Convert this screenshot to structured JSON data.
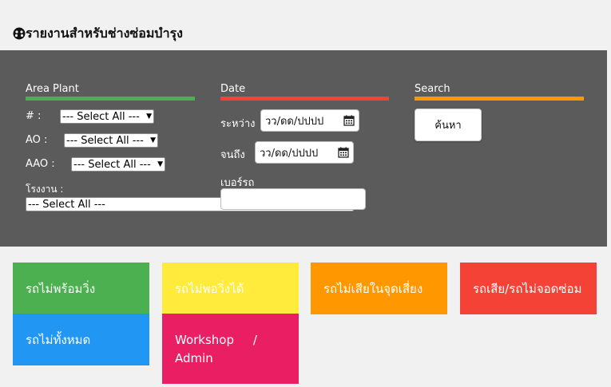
{
  "header": {
    "title": "รายงานสำหรับช่างซ่อมบำรุง",
    "icon": "gauge-icon"
  },
  "filters": {
    "area": {
      "title": "Area Plant",
      "color": "#4caf50",
      "hash_label": "# :",
      "hash_value": "--- Select All ---",
      "ao_label": "AO :",
      "ao_value": "--- Select All ---",
      "aao_label": "AAO :",
      "aao_value": "--- Select All ---",
      "plant_label": "โรงงาน :",
      "plant_value": "--- Select All ---"
    },
    "date": {
      "title": "Date",
      "color": "#f44336",
      "from_label": "ระหว่าง",
      "from_placeholder": "วว/ดด/ปปปป",
      "to_label": "จนถึง",
      "to_placeholder": "วว/ดด/ปปปป",
      "plate_label": "เบอร์รถ",
      "plate_value": ""
    },
    "search": {
      "title": "Search",
      "color": "#ff9800",
      "button_label": "ค้นหา"
    }
  },
  "tiles": [
    {
      "label": "รถไม่พร้อมวิ่ง",
      "color": "#4caf50"
    },
    {
      "label": "รถไม่พอวิ่งได้",
      "color": "#ffeb3b"
    },
    {
      "label": "รถไม่เสียในจุดเสี่ยง",
      "color": "#ff9800"
    },
    {
      "label": "รถเสีย/รถไม่จอดซ่อม",
      "color": "#f44336"
    },
    {
      "label": "รถไม่ทั้งหมด",
      "color": "#2196f3"
    },
    {
      "label_line1": "Workshop",
      "label_slash": "/",
      "label_line2": "Admin",
      "color": "#e91e63"
    }
  ]
}
